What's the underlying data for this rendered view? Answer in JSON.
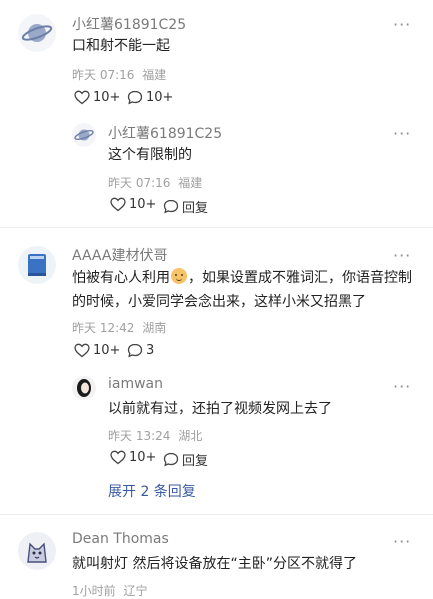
{
  "colors": {
    "name": "#7a7a7a",
    "meta": "#a0a0a0",
    "link": "#3a5aa0"
  },
  "comments": [
    {
      "username": "小红薯61891C25",
      "content": "口和射不能一起",
      "time": "昨天 07:16",
      "location": "福建",
      "likes": "10+",
      "comments": "10+",
      "avatar_icon": "planet-icon"
    },
    {
      "username": "小红薯61891C25",
      "content": "这个有限制的",
      "time": "昨天 07:16",
      "location": "福建",
      "likes": "10+",
      "reply_label": "回复",
      "avatar_icon": "planet-icon"
    },
    {
      "username": "AAAA建材伏哥",
      "content_part1": "怕被有心人利用",
      "content_part2": "，如果设置成不雅词汇，你语音控制的时候，小爱同学会念出来，这样小米又招黑了",
      "time": "昨天 12:42",
      "location": "湖南",
      "likes": "10+",
      "comments": "3",
      "avatar_icon": "book-icon",
      "emoji_icon": "smile-emoji-icon"
    },
    {
      "username": "iamwan",
      "content": "以前就有过，还拍了视频发网上去了",
      "time": "昨天 13:24",
      "location": "湖北",
      "likes": "10+",
      "reply_label": "回复",
      "avatar_icon": "portrait-icon"
    },
    {
      "username": "Dean Thomas",
      "content": "就叫射灯 然后将设备放在“主卧”分区不就得了",
      "time": "1小时前",
      "location": "辽宁",
      "avatar_icon": "dog-icon"
    }
  ],
  "expand_replies": "展开 2 条回复",
  "more_label": "···"
}
